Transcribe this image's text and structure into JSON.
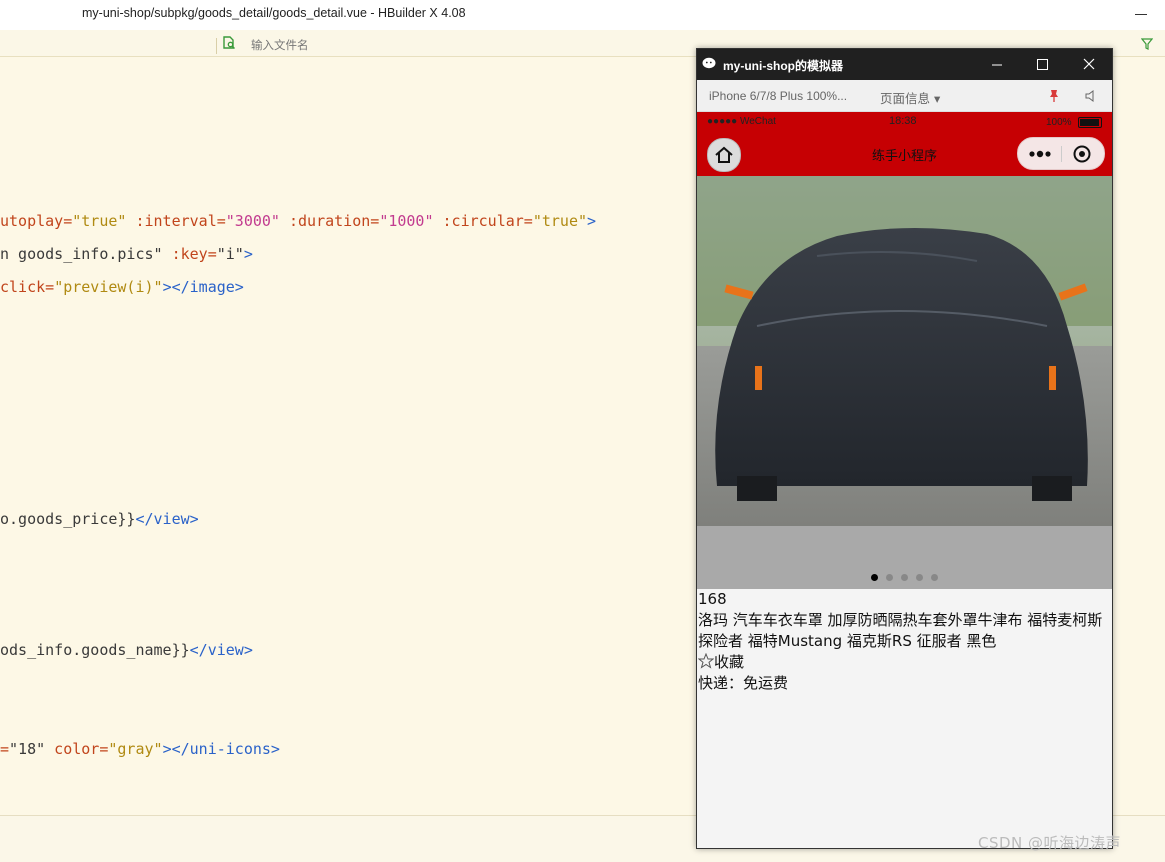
{
  "editor": {
    "window_title": "my-uni-shop/subpkg/goods_detail/goods_detail.vue - HBuilder X 4.08",
    "search_placeholder": "输入文件名",
    "code_lines": [
      {
        "parts": [
          {
            "t": "utoplay=",
            "c": "c-attr"
          },
          {
            "t": "\"true\"",
            "c": "c-val"
          },
          {
            "t": " :interval=",
            "c": "c-attr"
          },
          {
            "t": "\"3000\"",
            "c": "c-strn"
          },
          {
            "t": " :duration=",
            "c": "c-attr"
          },
          {
            "t": "\"1000\"",
            "c": "c-strn"
          },
          {
            "t": " :circular=",
            "c": "c-attr"
          },
          {
            "t": "\"true\"",
            "c": "c-val"
          },
          {
            "t": ">",
            "c": "c-tag"
          }
        ]
      },
      {
        "parts": [
          {
            "t": "n goods_info.pics\"",
            "c": "c-plain"
          },
          {
            "t": " :key=",
            "c": "c-attr"
          },
          {
            "t": "\"i\"",
            "c": "c-plain"
          },
          {
            "t": ">",
            "c": "c-tag"
          }
        ]
      },
      {
        "parts": [
          {
            "t": "click=",
            "c": "c-attr"
          },
          {
            "t": "\"preview(i)\"",
            "c": "c-val"
          },
          {
            "t": "></image>",
            "c": "c-tag"
          }
        ]
      },
      {
        "parts": [
          {
            "t": "o.goods_price}}",
            "c": "c-plain"
          },
          {
            "t": "</view>",
            "c": "c-tag"
          }
        ]
      },
      {
        "parts": [
          {
            "t": "ods_info.goods_name}}",
            "c": "c-plain"
          },
          {
            "t": "</view>",
            "c": "c-tag"
          }
        ]
      },
      {
        "parts": [
          {
            "t": "=",
            "c": "c-attr"
          },
          {
            "t": "\"18\"",
            "c": "c-plain"
          },
          {
            "t": " color=",
            "c": "c-attr"
          },
          {
            "t": "\"gray\"",
            "c": "c-val"
          },
          {
            "t": "></uni-icons>",
            "c": "c-tag"
          }
        ]
      }
    ]
  },
  "simulator": {
    "window_title": "my-uni-shop的模拟器",
    "device_label": "iPhone 6/7/8 Plus 100%...",
    "page_info_label": "页面信息 ▾",
    "status": {
      "signal": "●●●●● WeChat",
      "time": "18:38",
      "battery": "100%"
    },
    "nav_title": "练手小程序",
    "swiper": {
      "slide_count": 5,
      "active_index": 0
    },
    "goods": {
      "price": "168",
      "name": "洛玛 汽车车衣车罩 加厚防晒隔热车套外罩牛津布 福特麦柯斯 探险者 福特Mustang 福克斯RS 征服者 黑色",
      "favorite": "收藏",
      "shipping": "快递：免运费"
    }
  },
  "watermark": "CSDN @听海边涛声",
  "colors": {
    "nav_red": "#c60003",
    "editor_bg": "#fdf8e6",
    "sim_title_bg": "#202020"
  }
}
